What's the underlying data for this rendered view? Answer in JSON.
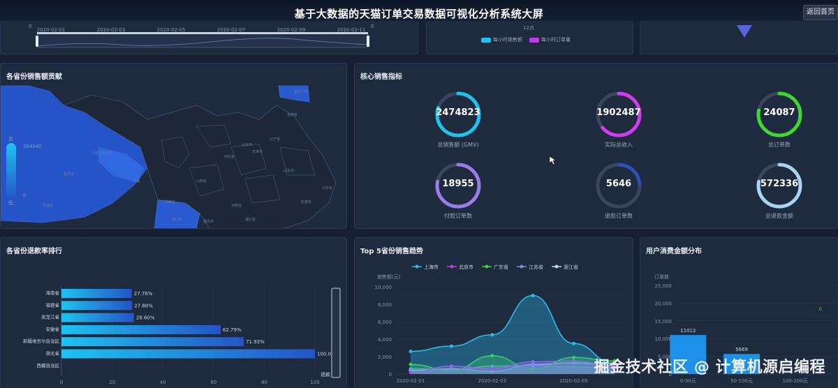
{
  "header": {
    "title": "基于大数据的天猫订单交易数据可视化分析系统大屏",
    "back_label": "返回首页"
  },
  "top_strip": {
    "dates": [
      "2020-02-01",
      "2020-02-03",
      "2020-02-05",
      "2020-02-07",
      "2020-02-09",
      "2020-02-11"
    ],
    "left_axis_zero": "0",
    "right_axis_zero": "0",
    "hour_label": "12点",
    "legend": [
      "每小时销售额",
      "每小时订单量"
    ]
  },
  "province_map": {
    "title": "各省份销售额贡献",
    "legend_high": "高",
    "legend_low": "低",
    "legend_max": "264040",
    "legend_min": "0",
    "place_labels": [
      "内蒙古自治区",
      "黑龙江省",
      "吉林省",
      "辽宁省",
      "甘肃省",
      "宁夏",
      "青海省",
      "陕西省",
      "山西省",
      "河北省",
      "北京市",
      "天津市",
      "山东省",
      "河南省",
      "湖北省",
      "四川省",
      "重庆市",
      "江苏省",
      "安徽省"
    ]
  },
  "kpis": {
    "title": "核心销售指标",
    "items": [
      {
        "value": "2474823",
        "label": "总销售额 (GMV)",
        "color": "#1ec3f0",
        "ratio": 0.8
      },
      {
        "value": "1902487",
        "label": "实际总收入",
        "color": "#d23bf0",
        "ratio": 0.64
      },
      {
        "value": "24087",
        "label": "总订单数",
        "color": "#3fd82f",
        "ratio": 0.78
      },
      {
        "value": "18955",
        "label": "付款订单数",
        "color": "#9b7be8",
        "ratio": 0.78
      },
      {
        "value": "5646",
        "label": "退款订单数",
        "color": "#2c4fb8",
        "ratio": 0.24
      },
      {
        "value": "572336",
        "label": "总退款金额",
        "color": "#a9d3f0",
        "ratio": 0.78
      }
    ]
  },
  "refund_rank": {
    "title": "各省份退款率排行",
    "axis_name": "退款",
    "chart_data": {
      "type": "bar",
      "orientation": "horizontal",
      "categories": [
        "海南省",
        "福建省",
        "黑龙江省",
        "安徽省",
        "新疆维吾尔自治区",
        "湖北省",
        "西藏自治区"
      ],
      "values": [
        27.76,
        27.88,
        28.6,
        62.79,
        71.93,
        100.0
      ],
      "value_labels": [
        "27.76%",
        "27.88%",
        "28.60%",
        "62.79%",
        "71.93%",
        "100.00%"
      ],
      "xlim": [
        0,
        100
      ],
      "x_ticks": [
        "0",
        "20",
        "40",
        "60",
        "80",
        "100"
      ]
    }
  },
  "top5_trend": {
    "title": "Top 5省份销售趋势",
    "ylabel": "销售额(元)",
    "chart_data": {
      "type": "line",
      "x": [
        "2020-02-01",
        "2020-02-02",
        "2020-02-03",
        "2020-02-04",
        "2020-02-05",
        "2020-02-06"
      ],
      "x_tick_labels": [
        "2020-02-01",
        "2020-02-03",
        "2020-02-05"
      ],
      "ylim": [
        0,
        10000
      ],
      "y_ticks": [
        "0",
        "2,000",
        "4,000",
        "6,000",
        "8,000",
        "10,000"
      ],
      "series": [
        {
          "name": "上海市",
          "color": "#2fb9ee",
          "values": [
            2600,
            3200,
            4500,
            9000,
            3500,
            1200
          ]
        },
        {
          "name": "北京市",
          "color": "#c13be8",
          "values": [
            200,
            900,
            600,
            1400,
            1500,
            900
          ]
        },
        {
          "name": "广东省",
          "color": "#3fd82f",
          "values": [
            1100,
            400,
            2100,
            600,
            1900,
            1500
          ]
        },
        {
          "name": "江苏省",
          "color": "#8c85e8",
          "values": [
            600,
            500,
            900,
            1000,
            800,
            700
          ]
        },
        {
          "name": "浙江省",
          "color": "#b9d9f2",
          "values": [
            400,
            600,
            300,
            1100,
            1300,
            1000
          ]
        }
      ]
    }
  },
  "spend_dist": {
    "title": "用户消费金额分布",
    "ylabel": "订单数",
    "chart_data": {
      "type": "bar",
      "categories": [
        "0-50元",
        "50-100元",
        "100-200元"
      ],
      "values": [
        11012,
        5669,
        null
      ],
      "value_labels": [
        "11012",
        "5669",
        "0"
      ],
      "ylim": [
        0,
        25000
      ],
      "y_ticks": [
        "0",
        "5,000",
        "10,000",
        "15,000",
        "20,000",
        "25,000"
      ]
    }
  },
  "watermark": "掘金技术社区 @ 计算机源启编程"
}
